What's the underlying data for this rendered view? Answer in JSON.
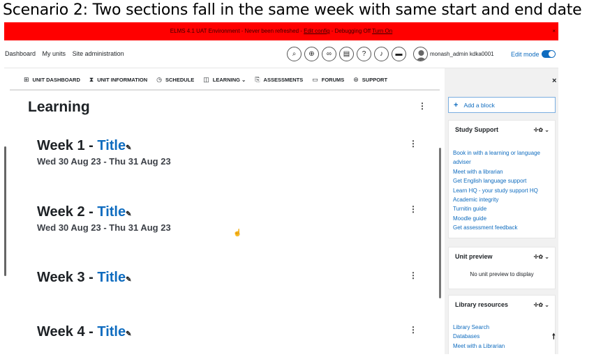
{
  "caption": "Scenario 2: Two sections fall in the same week with same start and end date",
  "env_bar": {
    "text_prefix": "ELMS 4.1 UAT Environment - Never been refreshed - ",
    "edit_config": "Edit config",
    "mid": " - Debugging Off ",
    "turn_on": "Turn On",
    "close": "×"
  },
  "topnav": {
    "links": [
      "Dashboard",
      "My units",
      "Site administration"
    ],
    "username": "monash_admin kdka0001",
    "edit_mode_label": "Edit mode",
    "edit_mode_on": true
  },
  "section_nav": [
    {
      "icon": "grid-icon",
      "glyph": "⊞",
      "label": "UNIT DASHBOARD"
    },
    {
      "icon": "hourglass-icon",
      "glyph": "⧗",
      "label": "UNIT INFORMATION"
    },
    {
      "icon": "clock-icon",
      "glyph": "◷",
      "label": "SCHEDULE"
    },
    {
      "icon": "book-icon",
      "glyph": "◫",
      "label": "LEARNING ⌄"
    },
    {
      "icon": "assessment-icon",
      "glyph": "⎘",
      "label": "ASSESSMENTS"
    },
    {
      "icon": "forum-icon",
      "glyph": "▭",
      "label": "FORUMS"
    },
    {
      "icon": "support-icon",
      "glyph": "⊛",
      "label": "SUPPORT"
    }
  ],
  "main": {
    "title": "Learning",
    "weeks": [
      {
        "prefix": "Week 1 - ",
        "title": "Title",
        "date": "Wed 30 Aug 23 - Thu 31 Aug 23"
      },
      {
        "prefix": "Week 2 - ",
        "title": "Title",
        "date": "Wed 30 Aug 23 - Thu 31 Aug 23"
      },
      {
        "prefix": "Week 3 - ",
        "title": "Title",
        "date": ""
      },
      {
        "prefix": "Week 4 - ",
        "title": "Title",
        "date": ""
      }
    ]
  },
  "drawer": {
    "add_block": "Add a block",
    "study_support": {
      "title": "Study Support",
      "links": [
        "Book in with a learning or language adviser",
        "Meet with a librarian",
        "Get English language support",
        "Learn HQ - your study support HQ",
        "Academic integrity",
        "Turnitin guide",
        "Moodle guide",
        "Get assessment feedback"
      ]
    },
    "unit_preview": {
      "title": "Unit preview",
      "body": "No unit preview to display"
    },
    "library_resources": {
      "title": "Library resources",
      "links": [
        "Library Search",
        "Databases",
        "Meet with a Librarian"
      ]
    },
    "block_controls": "✢✿ ⌄"
  },
  "colors": {
    "env_bar": "#ff0000",
    "link": "#0f6cbf",
    "drawer_bg": "#f1f1f1"
  }
}
